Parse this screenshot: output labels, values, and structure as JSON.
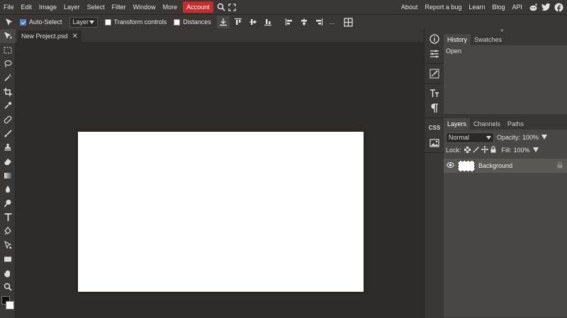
{
  "menu": {
    "items": [
      "File",
      "Edit",
      "Image",
      "Layer",
      "Select",
      "Filter",
      "Window",
      "More"
    ],
    "account_label": "Account",
    "right_links": [
      "About",
      "Report a bug",
      "Learn",
      "Blog",
      "API"
    ],
    "social_icons": [
      "reddit-icon",
      "twitter-icon",
      "facebook-icon"
    ],
    "accent_color": "#c62d2d"
  },
  "options": {
    "auto_select_label": "Auto-Select",
    "auto_select_checked": true,
    "layer_select_value": "Layer",
    "transform_controls_label": "Transform controls",
    "distances_label": "Distances",
    "more_label": "..."
  },
  "document": {
    "tab_title": "New Project.psd",
    "close_glyph": "✕"
  },
  "panels": {
    "history": {
      "tabs": [
        "History",
        "Swatches"
      ],
      "items": [
        "Open"
      ]
    },
    "layers": {
      "tabs": [
        "Layers",
        "Channels",
        "Paths"
      ],
      "blend_mode": "Normal",
      "opacity_label": "Opacity:",
      "opacity_value": "100%",
      "lock_label": "Lock:",
      "fill_label": "Fill:",
      "fill_value": "100%",
      "items": [
        {
          "name": "Background",
          "visible": true,
          "locked": true
        }
      ]
    }
  },
  "strip": {
    "css_label": "CSS"
  }
}
